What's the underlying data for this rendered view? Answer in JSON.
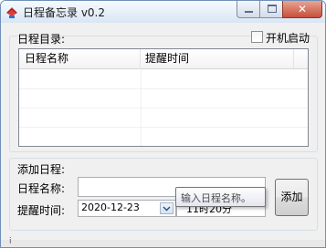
{
  "window": {
    "title": "日程备忘录 v0.2",
    "app_icon": "reminder-app-icon"
  },
  "title_controls": {
    "minimize_icon": "minimize-icon",
    "maximize_icon": "maximize-icon",
    "close_glyph": "✕"
  },
  "schedule_list": {
    "group_label": "日程目录:",
    "autostart_label": "开机启动",
    "autostart_checked": false,
    "columns": [
      "日程名称",
      "提醒时间"
    ],
    "rows": []
  },
  "add_form": {
    "group_label": "添加日程:",
    "name_label": "日程名称:",
    "name_value": "",
    "time_label": "提醒时间:",
    "date_value": "2020-12-23",
    "time_value": "11时20分",
    "add_button": "添加",
    "tooltip": "输入日程名称。"
  },
  "status": {
    "bottom_mark": "i"
  },
  "colors": {
    "accent": "#6f8fb8",
    "close_button": "#c7503a"
  }
}
